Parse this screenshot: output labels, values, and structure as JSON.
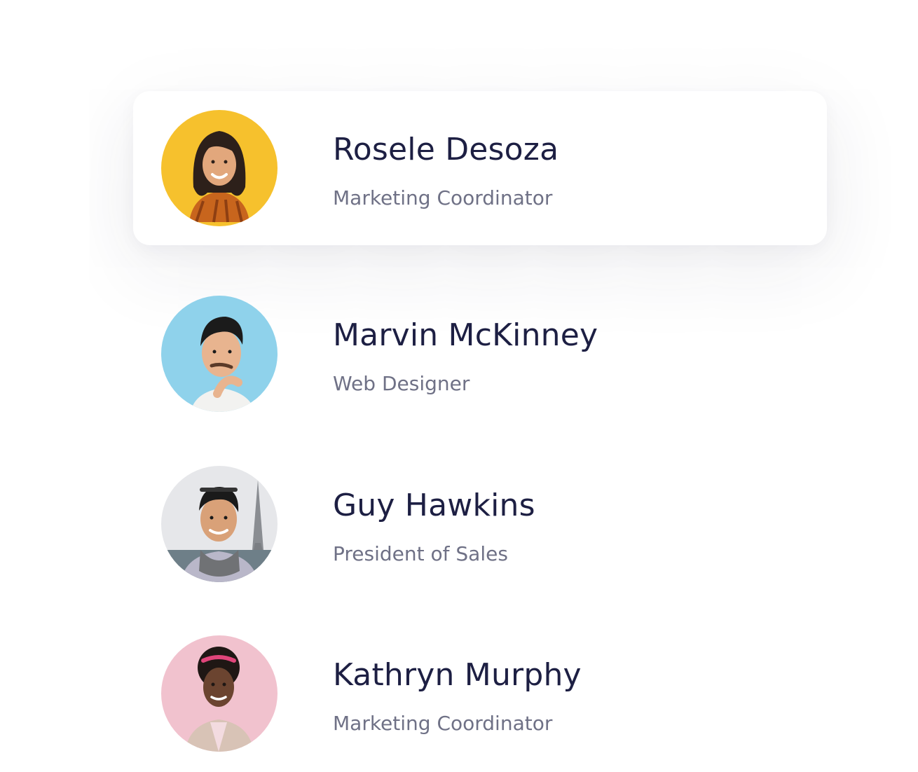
{
  "team": {
    "members": [
      {
        "name": "Rosele Desoza",
        "role": "Marketing Coordinator",
        "avatar_bg": "#f6c12d",
        "selected": true
      },
      {
        "name": "Marvin McKinney",
        "role": "Web Designer",
        "avatar_bg": "#8fd2eb",
        "selected": false
      },
      {
        "name": "Guy Hawkins",
        "role": "President of Sales",
        "avatar_bg": "#e6e7ea",
        "selected": false
      },
      {
        "name": "Kathryn Murphy",
        "role": "Marketing Coordinator",
        "avatar_bg": "#f1c2ce",
        "selected": false
      }
    ]
  },
  "colors": {
    "name_text": "#1d1f43",
    "role_text": "#6f7186",
    "card_background": "#ffffff"
  }
}
